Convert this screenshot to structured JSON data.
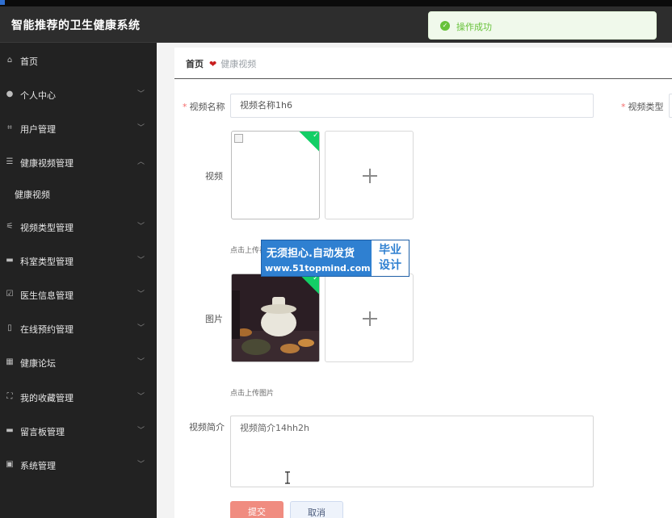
{
  "header": {
    "title": "智能推荐的卫生健康系统"
  },
  "toast": {
    "message": "操作成功",
    "color": "#67c23a"
  },
  "sidebar": {
    "items": [
      {
        "label": "首页",
        "icon": "home-icon"
      },
      {
        "label": "个人中心",
        "icon": "user-icon"
      },
      {
        "label": "用户管理",
        "icon": "crop-icon"
      },
      {
        "label": "健康视频管理",
        "icon": "list-icon",
        "expanded": true
      },
      {
        "label": "健康视频",
        "sub": true
      },
      {
        "label": "视频类型管理",
        "icon": "sliders-icon"
      },
      {
        "label": "科室类型管理",
        "icon": "chat-icon"
      },
      {
        "label": "医生信息管理",
        "icon": "check-icon"
      },
      {
        "label": "在线预约管理",
        "icon": "phone-icon"
      },
      {
        "label": "健康论坛",
        "icon": "chart-icon"
      },
      {
        "label": "我的收藏管理",
        "icon": "fullscreen-icon"
      },
      {
        "label": "留言板管理",
        "icon": "board-icon"
      },
      {
        "label": "系统管理",
        "icon": "system-icon"
      }
    ]
  },
  "breadcrumb": {
    "home": "首页",
    "current": "健康视频"
  },
  "form": {
    "name_label": "视频名称",
    "name_value": "视频名称1h6",
    "type_label": "视频类型",
    "video_label": "视频",
    "upload_video_tip": "点击上传视频",
    "image_label": "图片",
    "upload_image_tip": "点击上传图片",
    "intro_label": "视频简介",
    "intro_value": "视频简介14hh2h",
    "submit_label": "提交",
    "cancel_label": "取消"
  },
  "watermark": {
    "line1": "无须担心.自动发货",
    "line2": "www.51topmind.com",
    "side1": "毕业",
    "side2": "设计"
  },
  "colors": {
    "sidebar_bg": "#222222",
    "header_bg": "#2d2d2d",
    "accent_green": "#13ce66",
    "required": "#f56c6c"
  }
}
